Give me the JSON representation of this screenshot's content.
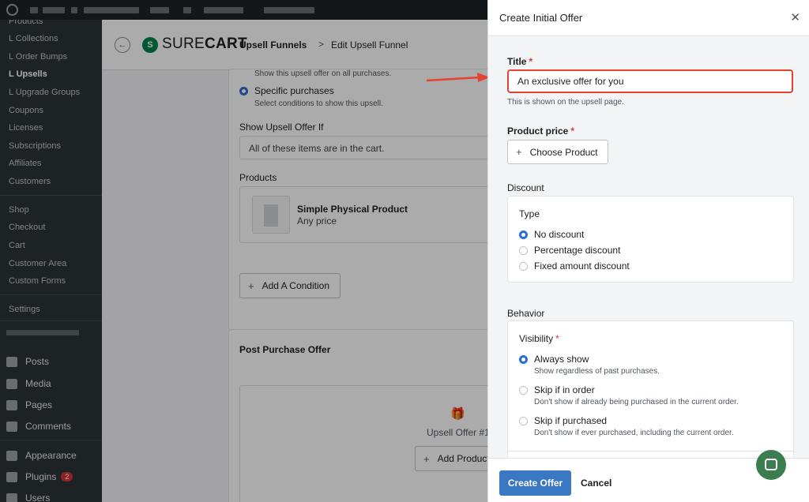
{
  "sidebar": {
    "items": [
      {
        "label": "Products"
      },
      {
        "label": "L Collections"
      },
      {
        "label": "L Order Bumps"
      },
      {
        "label": "L Upsells"
      },
      {
        "label": "L Upgrade Groups"
      },
      {
        "label": "Coupons"
      },
      {
        "label": "Licenses"
      },
      {
        "label": "Subscriptions"
      },
      {
        "label": "Affiliates"
      },
      {
        "label": "Customers"
      },
      {
        "label": "Shop"
      },
      {
        "label": "Checkout"
      },
      {
        "label": "Cart"
      },
      {
        "label": "Customer Area"
      },
      {
        "label": "Custom Forms"
      },
      {
        "label": "Settings"
      }
    ],
    "main_items": [
      {
        "label": "Posts",
        "icon": "pin-icon"
      },
      {
        "label": "Media",
        "icon": "media-icon"
      },
      {
        "label": "Pages",
        "icon": "pages-icon"
      },
      {
        "label": "Comments",
        "icon": "comments-icon"
      },
      {
        "label": "Appearance",
        "icon": "brush-icon"
      },
      {
        "label": "Plugins",
        "icon": "plugin-icon",
        "badge": "2"
      },
      {
        "label": "Users",
        "icon": "users-icon"
      }
    ]
  },
  "header": {
    "brand_sure": "SURE",
    "brand_cart": "CART",
    "crumb1": "Upsell Funnels",
    "crumb2": "Edit Upsell Funnel",
    "sep": ">"
  },
  "main": {
    "all_purchases_desc": "Show this upsell offer on all purchases.",
    "specific_label": "Specific purchases",
    "specific_desc": "Select conditions to show this upsell.",
    "show_if_label": "Show Upsell Offer If",
    "show_if_value": "All of these items are in the cart.",
    "products_label": "Products",
    "product_name": "Simple Physical Product",
    "product_price": "Any price",
    "add_condition": "Add A Condition",
    "post_purchase_title": "Post Purchase Offer",
    "upsell_offer": "Upsell Offer #1",
    "add_product": "Add Product"
  },
  "drawer": {
    "title": "Create Initial Offer",
    "title_label": "Title",
    "title_value": "An exclusive offer for you",
    "title_help": "This is shown on the upsell page.",
    "price_label": "Product price",
    "choose_product": "Choose Product",
    "discount_label": "Discount",
    "type_label": "Type",
    "discount_options": [
      "No discount",
      "Percentage discount",
      "Fixed amount discount"
    ],
    "behavior_label": "Behavior",
    "visibility_label": "Visibility",
    "visibility_options": [
      {
        "label": "Always show",
        "desc": "Show regardless of past purchases."
      },
      {
        "label": "Skip if in order",
        "desc": "Don't show if already being purchased in the current order."
      },
      {
        "label": "Skip if purchased",
        "desc": "Don't show if ever purchased, including the current order."
      }
    ],
    "required_mark": "*",
    "create_button": "Create Offer",
    "cancel_button": "Cancel"
  },
  "colors": {
    "accent": "#3a78c4",
    "highlight": "#e5432f",
    "brand": "#01824c"
  }
}
